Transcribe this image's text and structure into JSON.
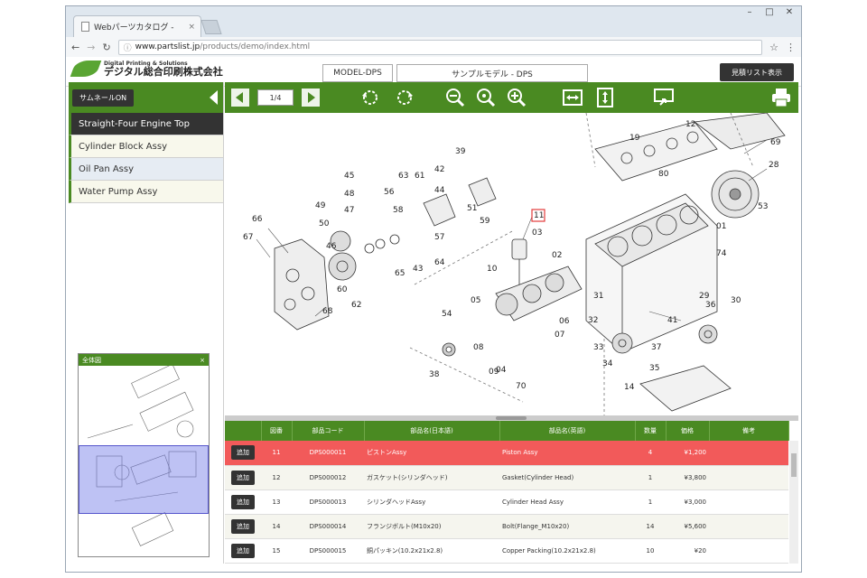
{
  "browser": {
    "tab_title": "Webパーツカタログ - ",
    "tab_close": "×",
    "url_host": "www.partslist.jp",
    "url_path": "/products/demo/index.html",
    "win_minimize": "–",
    "win_maximize": "□",
    "win_close": "✕"
  },
  "header": {
    "logo_en": "Digital Printing & Solutions",
    "logo_jp": "デジタル総合印刷株式会社",
    "model_code": "MODEL-DPS",
    "model_name": "サンプルモデル - DPS",
    "estimate_button": "見積リスト表示"
  },
  "sidebar": {
    "thumbnail_button": "サムネールON",
    "items": [
      {
        "label": "Straight-Four Engine Top"
      },
      {
        "label": "Cylinder Block Assy"
      },
      {
        "label": "Oil Pan Assy"
      },
      {
        "label": "Water Pump Assy"
      }
    ],
    "overview_title": "全体図",
    "overview_close": "×"
  },
  "toolbar": {
    "page": "1/4"
  },
  "diagram": {
    "callouts": [
      "39",
      "42",
      "61",
      "63",
      "56",
      "44",
      "58",
      "45",
      "48",
      "49",
      "47",
      "50",
      "46",
      "51",
      "59",
      "60",
      "57",
      "64",
      "43",
      "65",
      "62",
      "66",
      "67",
      "68",
      "11",
      "03",
      "02",
      "10",
      "05",
      "54",
      "06",
      "07",
      "08",
      "09",
      "04",
      "70",
      "38",
      "12",
      "19",
      "80",
      "01",
      "53",
      "28",
      "69",
      "74",
      "41",
      "31",
      "32",
      "33",
      "34",
      "37",
      "35",
      "36",
      "30",
      "29",
      "14"
    ],
    "highlight_callout": "11"
  },
  "table": {
    "headers": [
      "",
      "図番",
      "部品コード",
      "部品名(日本語)",
      "部品名(英語)",
      "数量",
      "価格",
      "備考"
    ],
    "add_label": "追加",
    "rows": [
      {
        "no": "11",
        "code": "DPS000011",
        "name_jp": "ピストンAssy",
        "name_en": "Piston Assy",
        "qty": "4",
        "price": "¥1,200",
        "note": "",
        "selected": true
      },
      {
        "no": "12",
        "code": "DPS000012",
        "name_jp": "ガスケット(シリンダヘッド)",
        "name_en": "Gasket(Cylinder Head)",
        "qty": "1",
        "price": "¥3,800",
        "note": "",
        "selected": false
      },
      {
        "no": "13",
        "code": "DPS000013",
        "name_jp": "シリンダヘッドAssy",
        "name_en": "Cylinder Head Assy",
        "qty": "1",
        "price": "¥3,000",
        "note": "",
        "selected": false
      },
      {
        "no": "14",
        "code": "DPS000014",
        "name_jp": "フランジボルト(M10x20)",
        "name_en": "Bolt(Flange_M10x20)",
        "qty": "14",
        "price": "¥5,600",
        "note": "",
        "selected": false
      },
      {
        "no": "15",
        "code": "DPS000015",
        "name_jp": "銅パッキン(10.2x21x2.8)",
        "name_en": "Copper Packing(10.2x21x2.8)",
        "qty": "10",
        "price": "¥20",
        "note": "",
        "selected": false
      }
    ]
  },
  "colors": {
    "accent_green": "#4a8a22",
    "selected_row": "#f25a5a",
    "highlight_callout": "#e23b3b"
  }
}
